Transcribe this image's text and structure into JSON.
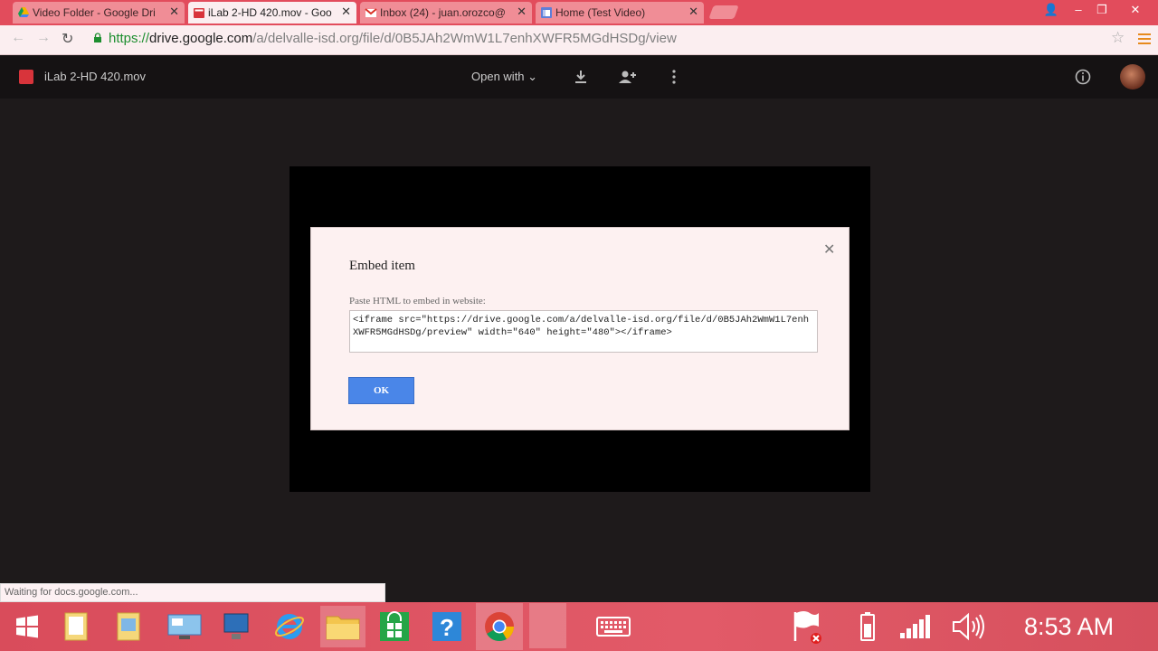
{
  "browser": {
    "tabs": [
      {
        "title": "Video Folder - Google Dri",
        "favicon": "google-drive-icon"
      },
      {
        "title": "iLab 2-HD 420.mov - Goo",
        "favicon": "video-file-icon"
      },
      {
        "title": "Inbox (24) - juan.orozco@",
        "favicon": "gmail-icon"
      },
      {
        "title": "Home (Test Video)",
        "favicon": "sites-icon"
      }
    ],
    "url_protocol": "https://",
    "url_host": "drive.google.com",
    "url_path": "/a/delvalle-isd.org/file/d/0B5JAh2WmW1L7enhXWFR5MGdHSDg/view"
  },
  "viewer": {
    "file_name": "iLab 2-HD 420.mov",
    "open_with_label": "Open with"
  },
  "dialog": {
    "title": "Embed item",
    "label": "Paste HTML to embed in website:",
    "embed_code": "<iframe src=\"https://drive.google.com/a/delvalle-isd.org/file/d/0B5JAh2WmW1L7enhXWFR5MGdHSDg/preview\" width=\"640\" height=\"480\"></iframe>",
    "ok_label": "OK"
  },
  "status_text": "Waiting for docs.google.com...",
  "taskbar": {
    "time": "8:53 AM"
  },
  "colors": {
    "tab_strip": "#e24c5c",
    "ok_button": "#4a86e8",
    "dialog_bg": "#fdf1f1"
  }
}
